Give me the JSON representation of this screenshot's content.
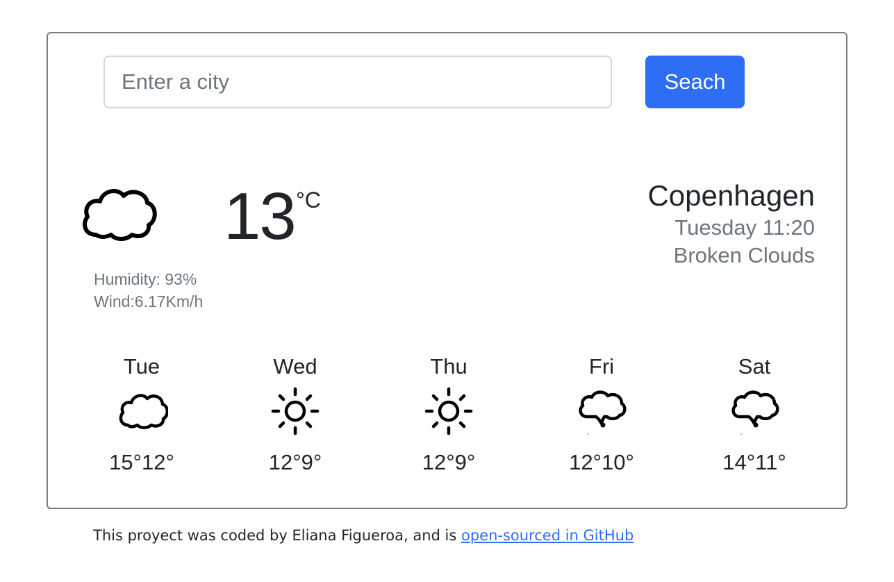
{
  "search": {
    "placeholder": "Enter a city",
    "value": "",
    "button_label": "Seach"
  },
  "current": {
    "icon": "cloud-icon",
    "temperature": "13",
    "unit": "°C",
    "humidity": "Humidity: 93%",
    "wind": "Wind:6.17Km/h",
    "city": "Copenhagen",
    "datetime": "Tuesday 11:20",
    "description": "Broken Clouds"
  },
  "forecast": [
    {
      "day": "Tue",
      "icon": "cloud-icon",
      "temps": "15°12°"
    },
    {
      "day": "Wed",
      "icon": "sun-icon",
      "temps": "12°9°"
    },
    {
      "day": "Thu",
      "icon": "sun-icon",
      "temps": "12°9°"
    },
    {
      "day": "Fri",
      "icon": "rain-cloud-icon",
      "temps": "12°10°"
    },
    {
      "day": "Sat",
      "icon": "rain-cloud-icon",
      "temps": "14°11°"
    }
  ],
  "footer": {
    "text": "This proyect was coded by Eliana Figueroa, and is ",
    "link_text": "open-sourced in GitHub"
  },
  "colors": {
    "accent": "#2d6ef5",
    "muted_text": "#6c757d",
    "card_border": "#7a7a7a"
  }
}
